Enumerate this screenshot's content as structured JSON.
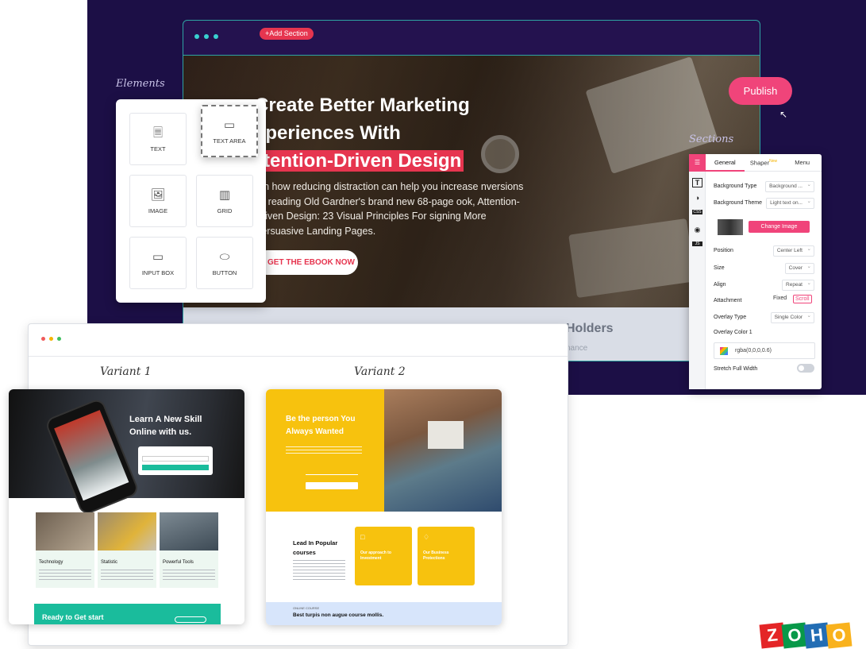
{
  "editor": {
    "add_section": "+Add Section",
    "publish": "Publish",
    "elements_label": "Elements",
    "sections_label": "Sections",
    "hero": {
      "title_line1": "Create Better Marketing",
      "title_line2": "xperiences With",
      "title_line3": "ttention-Driven Design",
      "body": "arn how reducing distraction can help you increase nversions by reading Old Gardner's brand new 68-page ook, Attention-Driven Design: 23 Visual Principles For signing More Persuasive Landing Pages.",
      "cta": "GET THE EBOOK NOW"
    },
    "strip_title": "Holders",
    "strip_sub": "nance"
  },
  "elements_panel": {
    "tiles": [
      {
        "label": "TEXT",
        "icon": "text-element-icon"
      },
      {
        "label": "TEXT AREA",
        "icon": "text-area-icon"
      },
      {
        "label": "IMAGE",
        "icon": "image-icon"
      },
      {
        "label": "GRID",
        "icon": "grid-icon"
      },
      {
        "label": "INPUT BOX",
        "icon": "input-box-icon"
      },
      {
        "label": "BUTTON",
        "icon": "button-icon"
      }
    ]
  },
  "sections_panel": {
    "tabs": [
      "General",
      "Shaper",
      "Menu"
    ],
    "new_badge": "New",
    "rail_icons": [
      "sections-icon",
      "text-icon",
      "paint-icon",
      "css-icon",
      "eye-icon",
      "js-icon"
    ],
    "rail_text": {
      "text": "T",
      "css": "CSS",
      "js": "JS"
    },
    "properties": {
      "background_type": {
        "label": "Background Type",
        "value": "Background ..."
      },
      "background_theme": {
        "label": "Background Theme",
        "value": "Light text on..."
      },
      "change_image": "Change Image",
      "position": {
        "label": "Position",
        "value": "Center Left"
      },
      "size": {
        "label": "Size",
        "value": "Cover"
      },
      "align": {
        "label": "Align",
        "value": "Repeat"
      },
      "attachment": {
        "label": "Attachment",
        "fixed": "Fixed",
        "scroll": "Scroll"
      },
      "overlay_type": {
        "label": "Overlay Type",
        "value": "Single Color"
      },
      "overlay_color": {
        "label": "Overlay Color 1",
        "value": "rgba(0,0,0,0.6)"
      },
      "stretch": {
        "label": "Stretch Full Width",
        "on": false
      }
    }
  },
  "variants": {
    "label_v1": "Variant 1",
    "label_v2": "Variant 2",
    "v1": {
      "headline": "Learn A New Skill Online with us.",
      "cards": [
        "Technology",
        "Statistic",
        "Powerful Tools"
      ],
      "cta": "Ready to Get start"
    },
    "v2": {
      "headline": "Be the person You Always Wanted",
      "lead": "Lead In Popular courses",
      "card1": "Our approach to Investment",
      "card2": "Our Business Protections",
      "footer_small": "ONLINE COURSE",
      "footer_title": "Best turpis non augue course mollis."
    }
  },
  "brand": {
    "logo_letters": [
      "Z",
      "O",
      "H",
      "O"
    ]
  },
  "colors": {
    "accent": "#f0447a",
    "editor_bg": "#1c0f46",
    "teal": "#1abc9c",
    "yellow": "#f7c20e"
  }
}
